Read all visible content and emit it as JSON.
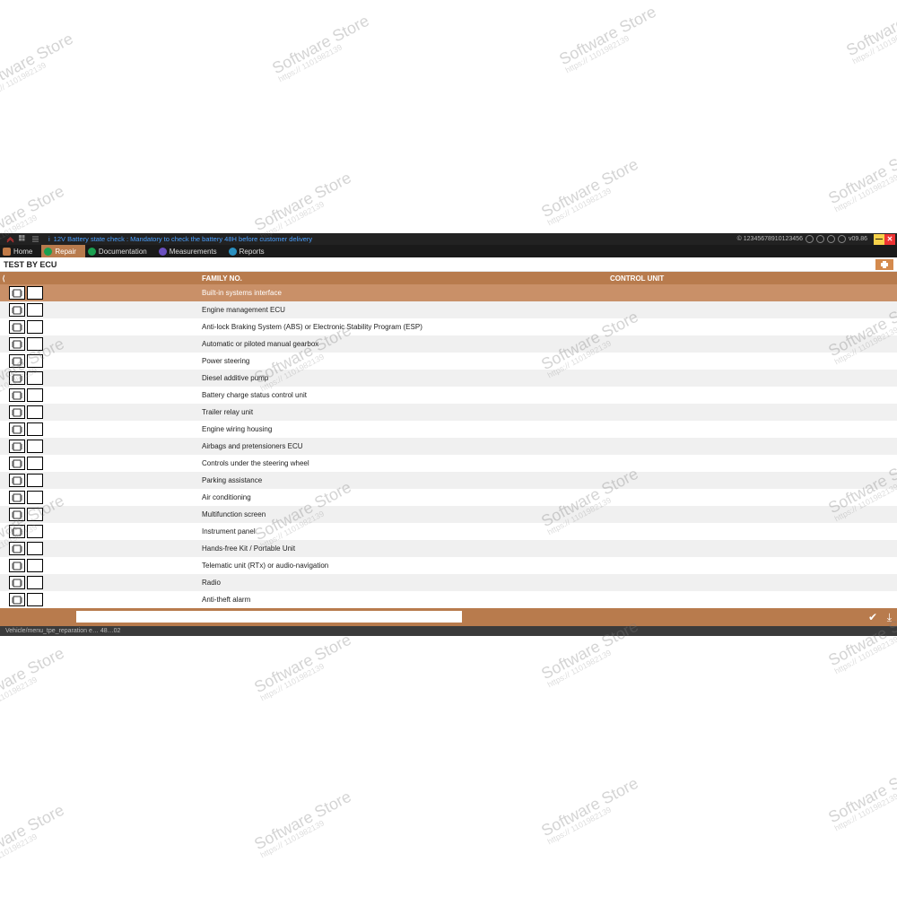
{
  "topbar": {
    "info_prefix": "i",
    "message": "12V Battery state check : Mandatory to check the battery 48H before customer delivery",
    "session": "© 12345678910123456",
    "version": "v09.86"
  },
  "tabs": {
    "home": "Home",
    "repair": "Repair",
    "documentation": "Documentation",
    "measurements": "Measurements",
    "reports": "Reports"
  },
  "page_title": "TEST BY ECU",
  "columns": {
    "family": "FAMILY NO.",
    "control_unit": "CONTROL UNIT"
  },
  "rows": [
    {
      "label": "Built-in systems interface",
      "selected": true
    },
    {
      "label": "Engine management ECU"
    },
    {
      "label": "Anti-lock Braking System (ABS) or Electronic Stability Program (ESP)"
    },
    {
      "label": "Automatic or piloted manual gearbox"
    },
    {
      "label": "Power steering"
    },
    {
      "label": "Diesel additive pump"
    },
    {
      "label": "Battery charge status control unit"
    },
    {
      "label": "Trailer relay unit"
    },
    {
      "label": "Engine wiring housing"
    },
    {
      "label": "Airbags and pretensioners ECU"
    },
    {
      "label": "Controls under the steering wheel"
    },
    {
      "label": "Parking assistance"
    },
    {
      "label": "Air conditioning"
    },
    {
      "label": "Multifunction screen"
    },
    {
      "label": "Instrument panel"
    },
    {
      "label": "Hands-free Kit / Portable Unit"
    },
    {
      "label": "Telematic unit (RTx) or audio-navigation"
    },
    {
      "label": "Radio"
    },
    {
      "label": "Anti-theft alarm"
    }
  ],
  "statusbar": "Vehicle/menu_tpe_reparation e… 48…02",
  "watermark": {
    "title": "Software Store",
    "sub": "https:// 1101982139"
  }
}
